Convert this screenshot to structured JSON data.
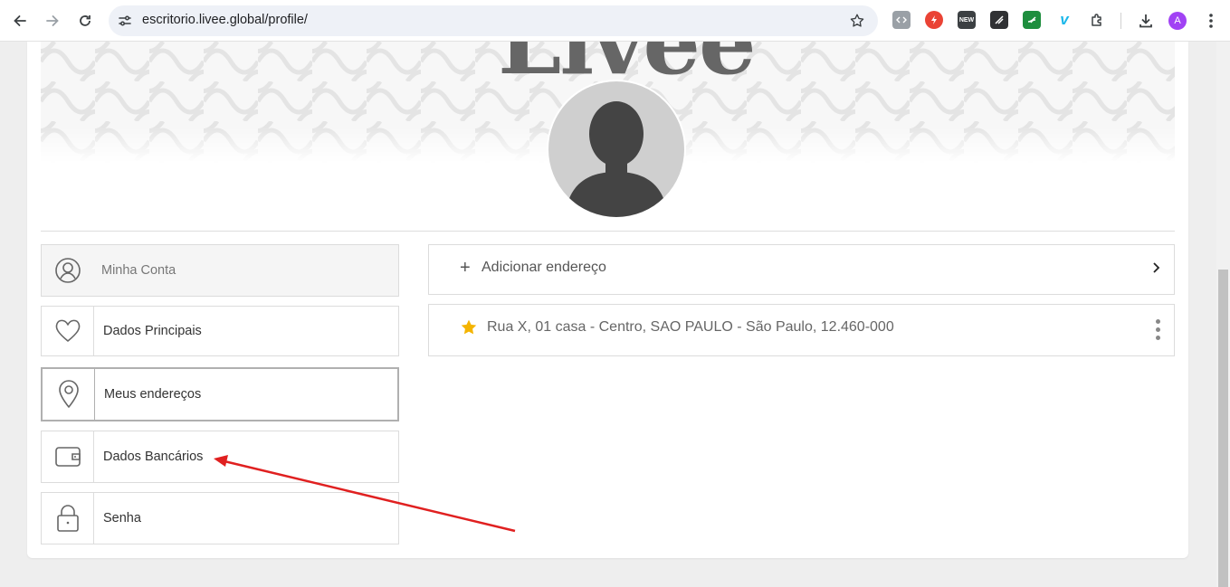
{
  "browser": {
    "url": "escritorio.livee.global/profile/",
    "profile_initial": "A",
    "extensions": [
      {
        "name": "code-extension-icon",
        "color": "#9aa0a6"
      },
      {
        "name": "red-circle-extension-icon",
        "color": "#ea4335"
      },
      {
        "name": "news-extension-icon",
        "color": "#3c4043",
        "text": "NEW"
      },
      {
        "name": "dark-extension-icon",
        "color": "#303134"
      },
      {
        "name": "green-extension-icon",
        "color": "#1e8e3e"
      },
      {
        "name": "vimeo-extension-icon",
        "color": "#1ab7ea",
        "text": "v"
      }
    ]
  },
  "banner": {
    "logo_text": "Livee"
  },
  "sidebar": {
    "header": "Minha Conta",
    "items": [
      {
        "label": "Dados Principais",
        "icon": "heart-icon"
      },
      {
        "label": "Meus endereços",
        "icon": "location-pin-icon"
      },
      {
        "label": "Dados Bancários",
        "icon": "wallet-icon"
      },
      {
        "label": "Senha",
        "icon": "lock-icon"
      }
    ]
  },
  "addresses": {
    "add_label": "Adicionar endereço",
    "add_symbol": "+",
    "list": [
      {
        "text": "Rua X, 01 casa - Centro, SAO PAULO - São Paulo, 12.460-000",
        "favorite": true
      }
    ]
  },
  "colors": {
    "star": "#f4b400",
    "annotation_arrow": "#e02020",
    "avatar": "#a142f4"
  }
}
